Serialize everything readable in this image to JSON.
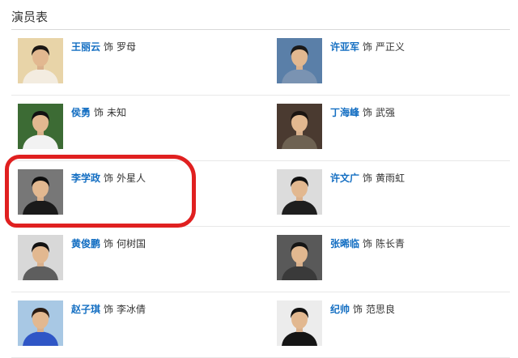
{
  "section": {
    "title": "演员表"
  },
  "cast": [
    {
      "actor": "王丽云",
      "as": "饰",
      "role": "罗母",
      "photo_bg": "#e8d4a8",
      "shirt": "#f3ece0",
      "hair": "#1c1814"
    },
    {
      "actor": "许亚军",
      "as": "饰",
      "role": "严正义",
      "photo_bg": "#5a7fa8",
      "shirt": "#7a93b2",
      "hair": "#1a1a1a"
    },
    {
      "actor": "侯勇",
      "as": "饰",
      "role": "未知",
      "photo_bg": "#3c6b34",
      "shirt": "#f2f2f2",
      "hair": "#111111"
    },
    {
      "actor": "丁海峰",
      "as": "饰",
      "role": "武强",
      "photo_bg": "#4a3a30",
      "shirt": "#6e6252",
      "hair": "#1b1411"
    },
    {
      "actor": "李学政",
      "as": "饰",
      "role": "外星人",
      "photo_bg": "#777777",
      "shirt": "#1a1a1a",
      "hair": "#0e0e0e"
    },
    {
      "actor": "许文广",
      "as": "饰",
      "role": "黄雨虹",
      "photo_bg": "#dcdcdc",
      "shirt": "#1e1e1e",
      "hair": "#101010"
    },
    {
      "actor": "黄俊鹏",
      "as": "饰",
      "role": "何树国",
      "photo_bg": "#d8d8d8",
      "shirt": "#5e5e5e",
      "hair": "#121212"
    },
    {
      "actor": "张晞临",
      "as": "饰",
      "role": "陈长青",
      "photo_bg": "#595959",
      "shirt": "#3a3a3a",
      "hair": "#151515"
    },
    {
      "actor": "赵子琪",
      "as": "饰",
      "role": "李冰倩",
      "photo_bg": "#a8c8e4",
      "shirt": "#2f56c6",
      "hair": "#2a1c14"
    },
    {
      "actor": "纪帅",
      "as": "饰",
      "role": "范思良",
      "photo_bg": "#ececec",
      "shirt": "#151515",
      "hair": "#111111"
    }
  ],
  "colors": {
    "link": "#136ec2",
    "text": "#333333",
    "annotation": "#e02020",
    "divider": "#e8e8e8"
  }
}
